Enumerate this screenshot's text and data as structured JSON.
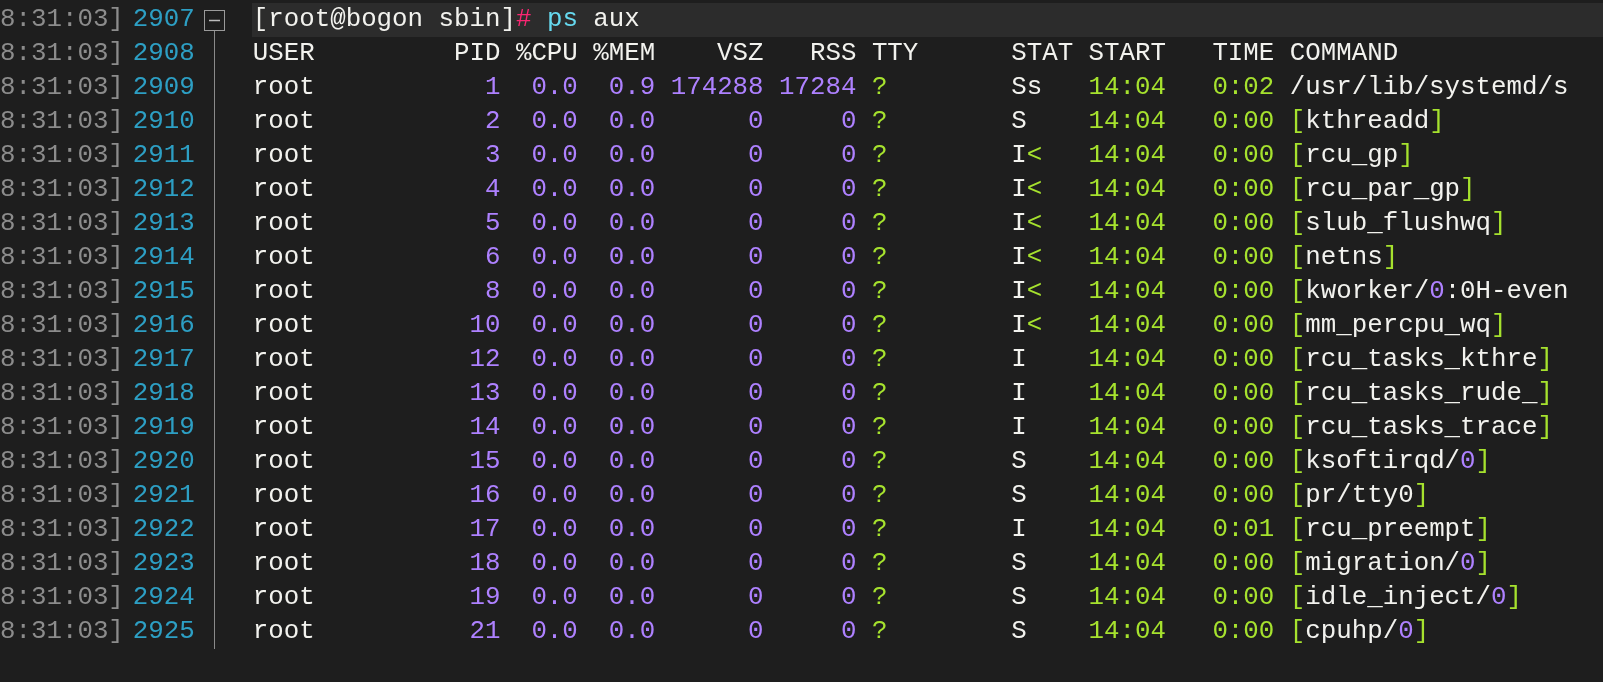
{
  "lines": [
    {
      "kind": "prompt",
      "timestamp": "8:31:03]",
      "line_number": "2907",
      "highlighted": true,
      "foldable": true,
      "prompt": "[root@bogon sbin]#",
      "command": "ps aux"
    },
    {
      "kind": "header",
      "timestamp": "8:31:03]",
      "line_number": "2908",
      "highlighted": false,
      "foldable": false,
      "columns": [
        "USER",
        "PID",
        "%CPU",
        "%MEM",
        "VSZ",
        "RSS",
        "TTY",
        "STAT",
        "START",
        "TIME",
        "COMMAND"
      ]
    },
    {
      "kind": "process",
      "timestamp": "8:31:03]",
      "line_number": "2909",
      "highlighted": false,
      "foldable": false,
      "cells": [
        "root",
        "1",
        "0.0",
        "0.9",
        "174288",
        "17284",
        "?",
        "Ss",
        "14:04",
        "0:02",
        "/usr/lib/systemd/s"
      ]
    },
    {
      "kind": "process",
      "timestamp": "8:31:03]",
      "line_number": "2910",
      "highlighted": false,
      "foldable": false,
      "cells": [
        "root",
        "2",
        "0.0",
        "0.0",
        "0",
        "0",
        "?",
        "S",
        "14:04",
        "0:00",
        "[kthreadd]"
      ]
    },
    {
      "kind": "process",
      "timestamp": "8:31:03]",
      "line_number": "2911",
      "highlighted": false,
      "foldable": false,
      "cells": [
        "root",
        "3",
        "0.0",
        "0.0",
        "0",
        "0",
        "?",
        "I<",
        "14:04",
        "0:00",
        "[rcu_gp]"
      ]
    },
    {
      "kind": "process",
      "timestamp": "8:31:03]",
      "line_number": "2912",
      "highlighted": false,
      "foldable": false,
      "cells": [
        "root",
        "4",
        "0.0",
        "0.0",
        "0",
        "0",
        "?",
        "I<",
        "14:04",
        "0:00",
        "[rcu_par_gp]"
      ]
    },
    {
      "kind": "process",
      "timestamp": "8:31:03]",
      "line_number": "2913",
      "highlighted": false,
      "foldable": false,
      "cells": [
        "root",
        "5",
        "0.0",
        "0.0",
        "0",
        "0",
        "?",
        "I<",
        "14:04",
        "0:00",
        "[slub_flushwq]"
      ]
    },
    {
      "kind": "process",
      "timestamp": "8:31:03]",
      "line_number": "2914",
      "highlighted": false,
      "foldable": false,
      "cells": [
        "root",
        "6",
        "0.0",
        "0.0",
        "0",
        "0",
        "?",
        "I<",
        "14:04",
        "0:00",
        "[netns]"
      ]
    },
    {
      "kind": "process",
      "timestamp": "8:31:03]",
      "line_number": "2915",
      "highlighted": false,
      "foldable": false,
      "cells": [
        "root",
        "8",
        "0.0",
        "0.0",
        "0",
        "0",
        "?",
        "I<",
        "14:04",
        "0:00",
        "[kworker/0:0H-even"
      ]
    },
    {
      "kind": "process",
      "timestamp": "8:31:03]",
      "line_number": "2916",
      "highlighted": false,
      "foldable": false,
      "cells": [
        "root",
        "10",
        "0.0",
        "0.0",
        "0",
        "0",
        "?",
        "I<",
        "14:04",
        "0:00",
        "[mm_percpu_wq]"
      ]
    },
    {
      "kind": "process",
      "timestamp": "8:31:03]",
      "line_number": "2917",
      "highlighted": false,
      "foldable": false,
      "cells": [
        "root",
        "12",
        "0.0",
        "0.0",
        "0",
        "0",
        "?",
        "I",
        "14:04",
        "0:00",
        "[rcu_tasks_kthre]"
      ]
    },
    {
      "kind": "process",
      "timestamp": "8:31:03]",
      "line_number": "2918",
      "highlighted": false,
      "foldable": false,
      "cells": [
        "root",
        "13",
        "0.0",
        "0.0",
        "0",
        "0",
        "?",
        "I",
        "14:04",
        "0:00",
        "[rcu_tasks_rude_]"
      ]
    },
    {
      "kind": "process",
      "timestamp": "8:31:03]",
      "line_number": "2919",
      "highlighted": false,
      "foldable": false,
      "cells": [
        "root",
        "14",
        "0.0",
        "0.0",
        "0",
        "0",
        "?",
        "I",
        "14:04",
        "0:00",
        "[rcu_tasks_trace]"
      ]
    },
    {
      "kind": "process",
      "timestamp": "8:31:03]",
      "line_number": "2920",
      "highlighted": false,
      "foldable": false,
      "cells": [
        "root",
        "15",
        "0.0",
        "0.0",
        "0",
        "0",
        "?",
        "S",
        "14:04",
        "0:00",
        "[ksoftirqd/0]"
      ]
    },
    {
      "kind": "process",
      "timestamp": "8:31:03]",
      "line_number": "2921",
      "highlighted": false,
      "foldable": false,
      "cells": [
        "root",
        "16",
        "0.0",
        "0.0",
        "0",
        "0",
        "?",
        "S",
        "14:04",
        "0:00",
        "[pr/tty0]"
      ]
    },
    {
      "kind": "process",
      "timestamp": "8:31:03]",
      "line_number": "2922",
      "highlighted": false,
      "foldable": false,
      "cells": [
        "root",
        "17",
        "0.0",
        "0.0",
        "0",
        "0",
        "?",
        "I",
        "14:04",
        "0:01",
        "[rcu_preempt]"
      ]
    },
    {
      "kind": "process",
      "timestamp": "8:31:03]",
      "line_number": "2923",
      "highlighted": false,
      "foldable": false,
      "cells": [
        "root",
        "18",
        "0.0",
        "0.0",
        "0",
        "0",
        "?",
        "S",
        "14:04",
        "0:00",
        "[migration/0]"
      ]
    },
    {
      "kind": "process",
      "timestamp": "8:31:03]",
      "line_number": "2924",
      "highlighted": false,
      "foldable": false,
      "cells": [
        "root",
        "19",
        "0.0",
        "0.0",
        "0",
        "0",
        "?",
        "S",
        "14:04",
        "0:00",
        "[idle_inject/0]"
      ]
    },
    {
      "kind": "process",
      "timestamp": "8:31:03]",
      "line_number": "2925",
      "highlighted": false,
      "foldable": false,
      "cells": [
        "root",
        "21",
        "0.0",
        "0.0",
        "0",
        "0",
        "?",
        "S",
        "14:04",
        "0:00",
        "[cpuhp/0]"
      ]
    }
  ]
}
